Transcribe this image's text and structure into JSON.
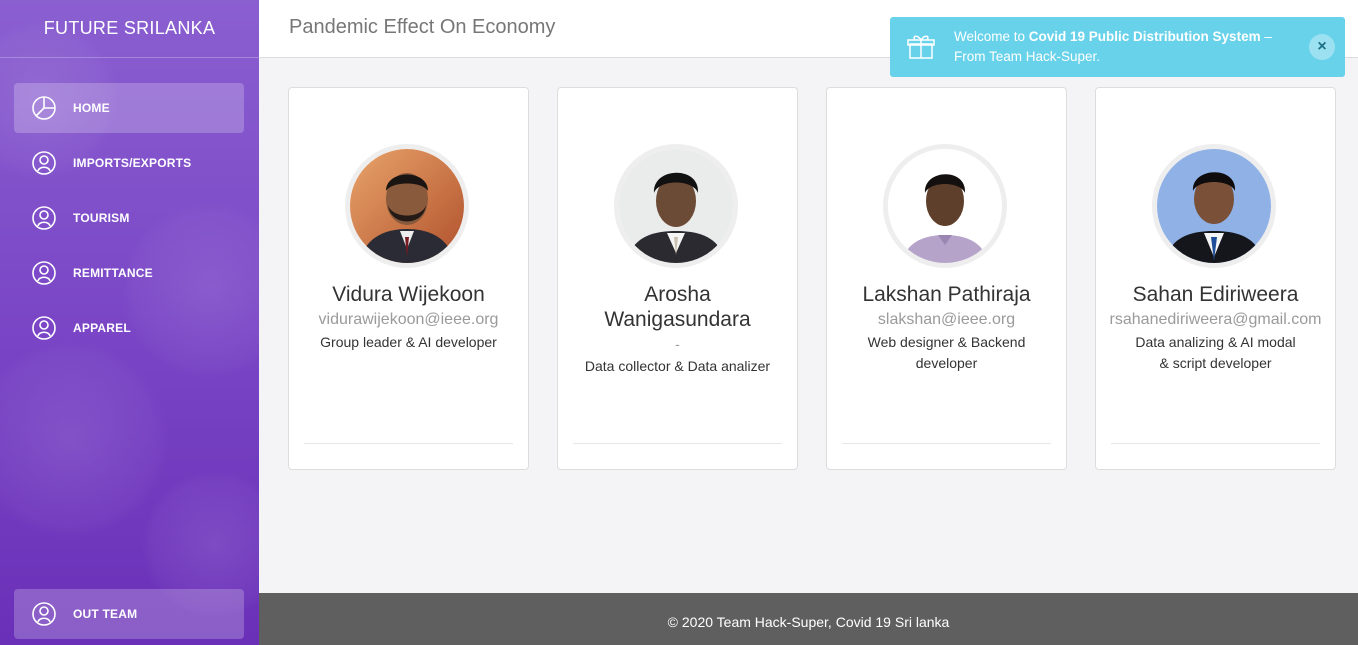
{
  "sidebar": {
    "brand": "FUTURE SRILANKA",
    "items": [
      {
        "label": "HOME",
        "icon": "pie-chart-icon",
        "active": true
      },
      {
        "label": "IMPORTS/EXPORTS",
        "icon": "user-icon",
        "active": false
      },
      {
        "label": "TOURISM",
        "icon": "user-icon",
        "active": false
      },
      {
        "label": "REMITTANCE",
        "icon": "user-icon",
        "active": false
      },
      {
        "label": "APPAREL",
        "icon": "user-icon",
        "active": false
      }
    ],
    "bottom_item": {
      "label": "OUT TEAM",
      "icon": "user-icon"
    }
  },
  "header": {
    "title": "Pandemic Effect On Economy"
  },
  "notification": {
    "prefix": "Welcome to ",
    "bold": "Covid 19 Public Distribution System",
    "suffix": " – From Team Hack-Super.",
    "icon": "gift-icon",
    "close": "×",
    "color": "#67d2ea"
  },
  "team": [
    {
      "name": "Vidura Wijekoon",
      "email": "vidurawijekoon@ieee.org",
      "role_line1": "Group leader & AI developer",
      "role_line2": ""
    },
    {
      "name": "Arosha Wanigasundara",
      "email": "-",
      "role_line1": "Data collector & Data analizer",
      "role_line2": ""
    },
    {
      "name": "Lakshan Pathiraja",
      "email": "slakshan@ieee.org",
      "role_line1": "Web designer & Backend",
      "role_line2": "developer"
    },
    {
      "name": "Sahan Ediriweera",
      "email": "rsahanediriweera@gmail.com",
      "role_line1": "Data analizing & AI modal",
      "role_line2": "& script developer"
    }
  ],
  "footer": {
    "text": "© 2020 Team Hack-Super, Covid 19 Sri lanka"
  },
  "colors": {
    "sidebar": "#7a46c6",
    "footer": "#5f5f5f",
    "notify": "#67d2ea"
  }
}
